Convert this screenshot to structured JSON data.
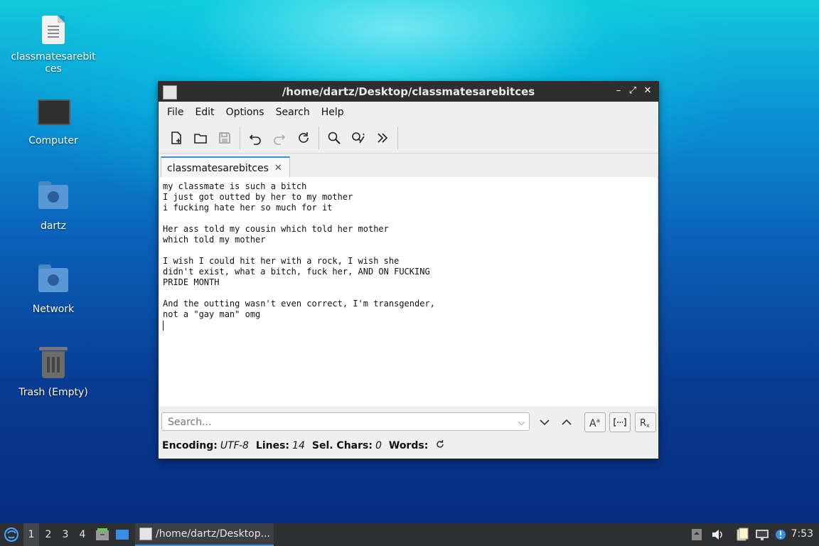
{
  "desktop": {
    "icons": [
      {
        "label": "classmatesarebitces",
        "icon": "text-document-icon"
      },
      {
        "label": "Computer",
        "icon": "computer-icon"
      },
      {
        "label": "dartz",
        "icon": "home-folder-icon"
      },
      {
        "label": "Network",
        "icon": "network-folder-icon"
      },
      {
        "label": "Trash (Empty)",
        "icon": "trash-icon"
      }
    ]
  },
  "window": {
    "title": "/home/dartz/Desktop/classmatesarebitces",
    "controls": {
      "minimize": "–",
      "maximize": "⤢",
      "close": "✕"
    },
    "menu": [
      "File",
      "Edit",
      "Options",
      "Search",
      "Help"
    ],
    "toolbar": [
      "new-file-icon",
      "open-folder-icon",
      "save-icon",
      "undo-icon",
      "redo-icon",
      "reload-icon",
      "find-icon",
      "replace-icon",
      "more-icon"
    ],
    "tab": {
      "label": "classmatesarebitces",
      "close": "✕"
    },
    "editor_text": "my classmate is such a bitch\nI just got outted by her to my mother\ni fucking hate her so much for it\n\nHer ass told my cousin which told her mother\nwhich told my mother\n\nI wish I could hit her with a rock, I wish she\ndidn't exist, what a bitch, fuck her, AND ON FUCKING\nPRIDE MONTH\n\nAnd the outting wasn't even correct, I'm transgender,\nnot a \"gay man\" omg\n",
    "search": {
      "placeholder": "Search...",
      "value": ""
    },
    "status": {
      "encoding_label": "Encoding:",
      "encoding_value": "UTF-8",
      "lines_label": "Lines:",
      "lines_value": "14",
      "sel_label": "Sel. Chars:",
      "sel_value": "0",
      "words_label": "Words:"
    }
  },
  "taskbar": {
    "workspaces": [
      "1",
      "2",
      "3",
      "4"
    ],
    "active_workspace": "1",
    "task_label": "/home/dartz/Desktop...",
    "clock": "7:53"
  },
  "colors": {
    "accent": "#3a8ee6",
    "titlebar": "#2e2e2e",
    "taskbar": "#2e2f33"
  }
}
